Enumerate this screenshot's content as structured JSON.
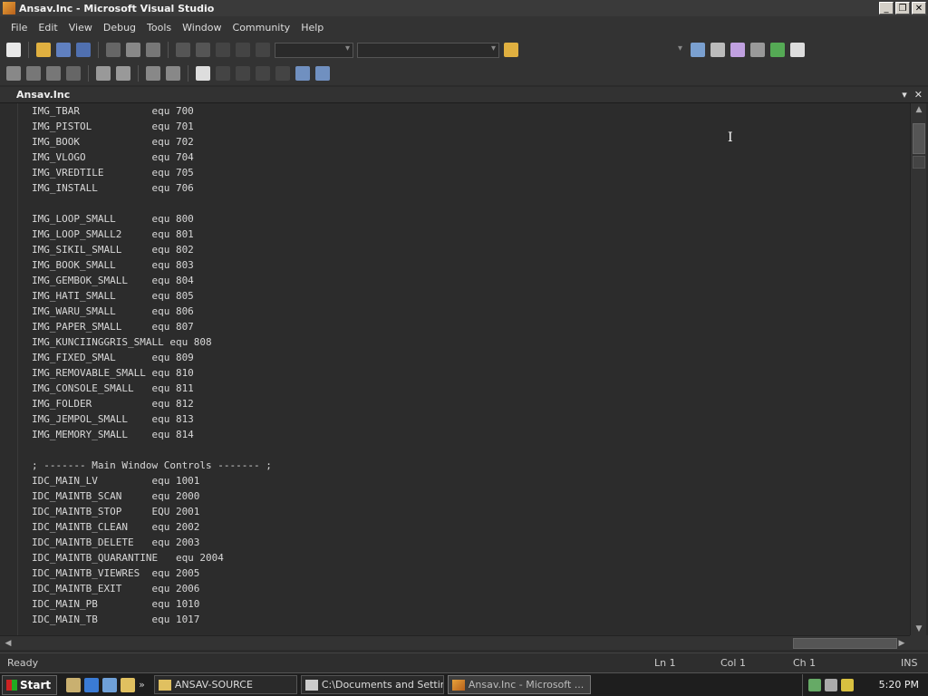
{
  "window": {
    "title": "Ansav.Inc - Microsoft Visual Studio"
  },
  "menu": [
    "File",
    "Edit",
    "View",
    "Debug",
    "Tools",
    "Window",
    "Community",
    "Help"
  ],
  "document_tab": {
    "name": "Ansav.Inc"
  },
  "code_lines": [
    "IMG_TBAR            equ 700",
    "IMG_PISTOL          equ 701",
    "IMG_BOOK            equ 702",
    "IMG_VLOGO           equ 704",
    "IMG_VREDTILE        equ 705",
    "IMG_INSTALL         equ 706",
    "",
    "IMG_LOOP_SMALL      equ 800",
    "IMG_LOOP_SMALL2     equ 801",
    "IMG_SIKIL_SMALL     equ 802",
    "IMG_BOOK_SMALL      equ 803",
    "IMG_GEMBOK_SMALL    equ 804",
    "IMG_HATI_SMALL      equ 805",
    "IMG_WARU_SMALL      equ 806",
    "IMG_PAPER_SMALL     equ 807",
    "IMG_KUNCIINGGRIS_SMALL equ 808",
    "IMG_FIXED_SMAL      equ 809",
    "IMG_REMOVABLE_SMALL equ 810",
    "IMG_CONSOLE_SMALL   equ 811",
    "IMG_FOLDER          equ 812",
    "IMG_JEMPOL_SMALL    equ 813",
    "IMG_MEMORY_SMALL    equ 814",
    "",
    "; ------- Main Window Controls ------- ;",
    "IDC_MAIN_LV         equ 1001",
    "IDC_MAINTB_SCAN     equ 2000",
    "IDC_MAINTB_STOP     EQU 2001",
    "IDC_MAINTB_CLEAN    equ 2002",
    "IDC_MAINTB_DELETE   equ 2003",
    "IDC_MAINTB_QUARANTINE   equ 2004",
    "IDC_MAINTB_VIEWRES  equ 2005",
    "IDC_MAINTB_EXIT     equ 2006",
    "IDC_MAIN_PB         equ 1010",
    "IDC_MAIN_TB         equ 1017"
  ],
  "status": {
    "ready": "Ready",
    "ln": "Ln 1",
    "col": "Col 1",
    "ch": "Ch 1",
    "mode": "INS"
  },
  "taskbar": {
    "start": "Start",
    "buttons": [
      "ANSAV-SOURCE",
      "C:\\Documents and Settin...",
      "Ansav.Inc - Microsoft ..."
    ],
    "clock": "5:20 PM"
  }
}
